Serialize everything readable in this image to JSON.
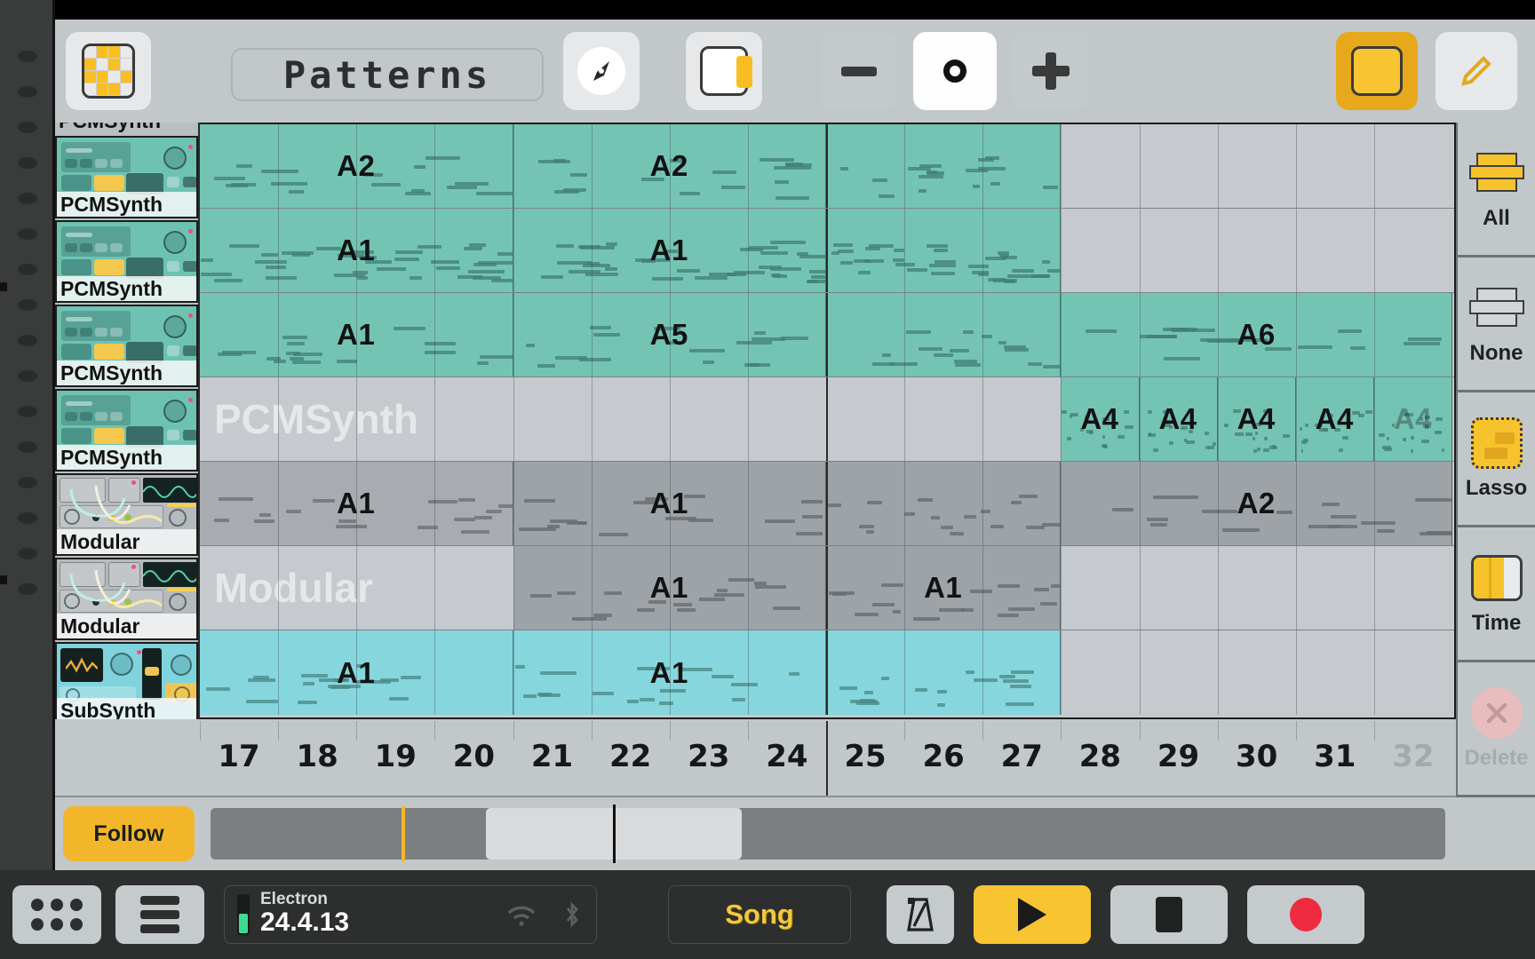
{
  "app": {
    "title": "Patterns",
    "device_name": "Electron",
    "firmware_version": "24.4.13"
  },
  "toolbar": {
    "logo_icon": "pattern-grid-icon",
    "pointer_icon": "pointer-tool-icon",
    "panel_icon": "side-panel-icon",
    "zoom_out_label": "−",
    "zoom_level_icon": "circle-zoom-icon",
    "zoom_in_label": "+",
    "color_swatch_icon": "yellow-color-swatch",
    "edit_icon": "pencil-edit-icon"
  },
  "tracks": [
    {
      "name": "PCMSynth",
      "kind": "pcm",
      "partial": true
    },
    {
      "name": "PCMSynth",
      "kind": "pcm",
      "partial": false
    },
    {
      "name": "PCMSynth",
      "kind": "pcm",
      "partial": false
    },
    {
      "name": "PCMSynth",
      "kind": "pcm",
      "partial": false
    },
    {
      "name": "PCMSynth",
      "kind": "pcm",
      "partial": false
    },
    {
      "name": "Modular",
      "kind": "modular",
      "partial": false
    },
    {
      "name": "Modular",
      "kind": "modular",
      "partial": false
    },
    {
      "name": "SubSynth",
      "kind": "sub",
      "partial": false
    }
  ],
  "ruler": {
    "bars": [
      {
        "label": "17",
        "dim": false
      },
      {
        "label": "18",
        "dim": false
      },
      {
        "label": "19",
        "dim": false
      },
      {
        "label": "20",
        "dim": false
      },
      {
        "label": "21",
        "dim": false
      },
      {
        "label": "22",
        "dim": false
      },
      {
        "label": "23",
        "dim": false
      },
      {
        "label": "24",
        "dim": false
      },
      {
        "label": "25",
        "dim": false
      },
      {
        "label": "26",
        "dim": false
      },
      {
        "label": "27",
        "dim": false
      },
      {
        "label": "28",
        "dim": false
      },
      {
        "label": "29",
        "dim": false
      },
      {
        "label": "30",
        "dim": false
      },
      {
        "label": "31",
        "dim": false
      },
      {
        "label": "32",
        "dim": true
      }
    ],
    "section_divider_bar": 25
  },
  "lanes": [
    {
      "track": "PCMSynth",
      "watermark": "",
      "clips": [
        {
          "label": "A2",
          "start": 17,
          "length": 4,
          "color": "teal",
          "faded": false
        },
        {
          "label": "A2",
          "start": 21,
          "length": 4,
          "color": "teal",
          "faded": false
        },
        {
          "label": "",
          "start": 25,
          "length": 3,
          "color": "teal",
          "faded": false
        }
      ]
    },
    {
      "track": "PCMSynth",
      "watermark": "",
      "clips": [
        {
          "label": "A1",
          "start": 17,
          "length": 4,
          "color": "teal",
          "faded": false
        },
        {
          "label": "A1",
          "start": 21,
          "length": 4,
          "color": "teal",
          "faded": false
        },
        {
          "label": "",
          "start": 25,
          "length": 3,
          "color": "teal",
          "faded": false
        }
      ]
    },
    {
      "track": "PCMSynth",
      "watermark": "",
      "clips": [
        {
          "label": "A1",
          "start": 17,
          "length": 4,
          "color": "teal",
          "faded": false
        },
        {
          "label": "A5",
          "start": 21,
          "length": 4,
          "color": "teal",
          "faded": false
        },
        {
          "label": "",
          "start": 25,
          "length": 3,
          "color": "teal",
          "faded": false
        },
        {
          "label": "A6",
          "start": 28,
          "length": 5,
          "color": "teal",
          "faded": false
        }
      ]
    },
    {
      "track": "PCMSynth",
      "watermark": "PCMSynth",
      "clips": [
        {
          "label": "A4",
          "start": 28,
          "length": 1,
          "color": "teal",
          "faded": false
        },
        {
          "label": "A4",
          "start": 29,
          "length": 1,
          "color": "teal",
          "faded": false
        },
        {
          "label": "A4",
          "start": 30,
          "length": 1,
          "color": "teal",
          "faded": false
        },
        {
          "label": "A4",
          "start": 31,
          "length": 1,
          "color": "teal",
          "faded": false
        },
        {
          "label": "A4",
          "start": 32,
          "length": 1,
          "color": "teal",
          "faded": true
        }
      ]
    },
    {
      "track": "Modular",
      "watermark": "",
      "clips": [
        {
          "label": "A1",
          "start": 17,
          "length": 4,
          "color": "gray",
          "faded": false
        },
        {
          "label": "A1",
          "start": 21,
          "length": 4,
          "color": "gray2",
          "faded": false
        },
        {
          "label": "",
          "start": 25,
          "length": 3,
          "color": "gray2",
          "faded": false
        },
        {
          "label": "A2",
          "start": 28,
          "length": 5,
          "color": "gray2",
          "faded": false
        }
      ]
    },
    {
      "track": "Modular",
      "watermark": "Modular",
      "clips": [
        {
          "label": "A1",
          "start": 21,
          "length": 4,
          "color": "gray2",
          "faded": false
        },
        {
          "label": "A1",
          "start": 25,
          "length": 3,
          "color": "gray2",
          "faded": false
        }
      ]
    },
    {
      "track": "SubSynth",
      "watermark": "",
      "clips": [
        {
          "label": "A1",
          "start": 17,
          "length": 4,
          "color": "cyan",
          "faded": false
        },
        {
          "label": "A1",
          "start": 21,
          "length": 4,
          "color": "cyan",
          "faded": false
        },
        {
          "label": "",
          "start": 25,
          "length": 3,
          "color": "cyan",
          "faded": false
        }
      ]
    }
  ],
  "side_panel": {
    "items": [
      {
        "label": "All",
        "icon": "select-all-icon",
        "disabled": false
      },
      {
        "label": "None",
        "icon": "select-none-icon",
        "disabled": false
      },
      {
        "label": "Lasso",
        "icon": "lasso-select-icon",
        "disabled": false
      },
      {
        "label": "Time",
        "icon": "time-select-icon",
        "disabled": false
      },
      {
        "label": "Delete",
        "icon": "delete-x-icon",
        "disabled": true
      }
    ]
  },
  "transport": {
    "follow_label": "Follow",
    "mode_label": "Song",
    "apps_icon": "apps-grid-icon",
    "menu_icon": "hamburger-menu-icon",
    "wifi_icon": "wifi-icon",
    "bluetooth_icon": "bluetooth-icon",
    "metronome_icon": "metronome-icon",
    "play_icon": "play-icon",
    "stop_icon": "stop-icon",
    "record_icon": "record-icon"
  },
  "colors": {
    "accent_yellow": "#f3b62a",
    "clip_teal": "#74c4b4",
    "clip_cyan": "#86d7dd",
    "clip_gray": "#a8acb0",
    "record_red": "#ef2b3f",
    "screen_bg": "#c2c7ca"
  }
}
